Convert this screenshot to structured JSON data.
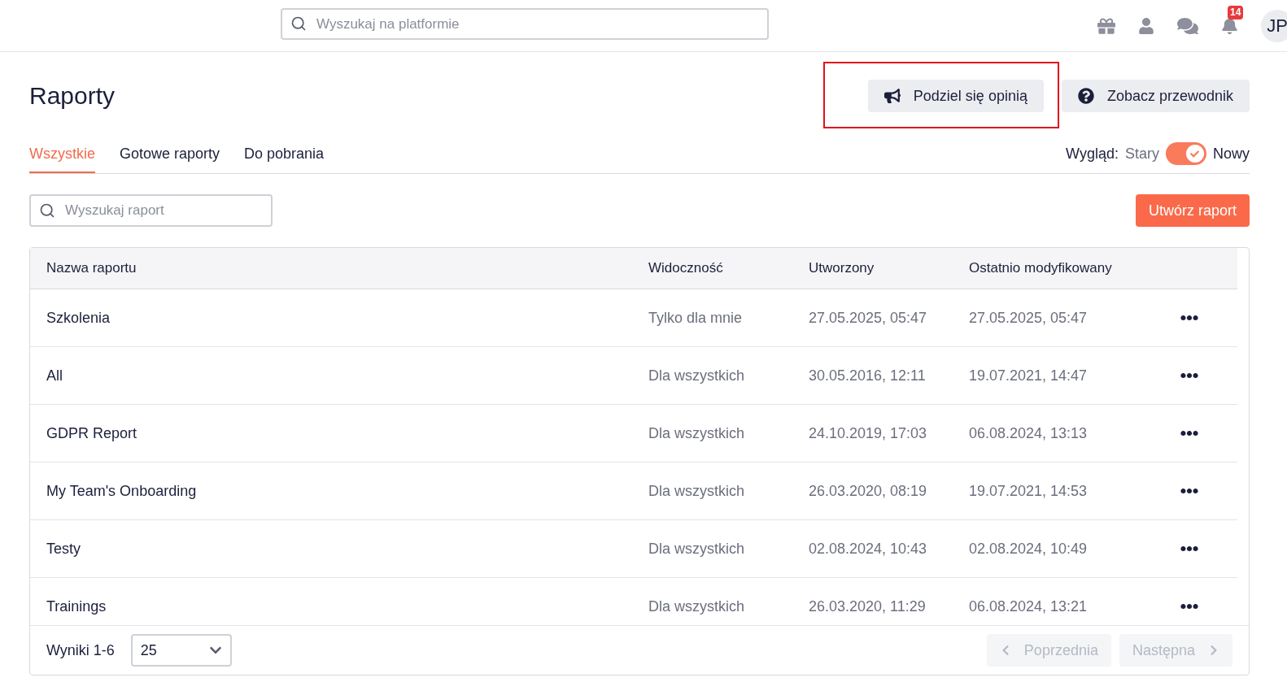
{
  "header": {
    "search": {
      "placeholder": "Wyszukaj na platformie"
    },
    "notifications_badge": "14",
    "avatar": "JP"
  },
  "page": {
    "title": "Raporty",
    "buttons": [
      {
        "kind": "feedback",
        "label": "Podziel się opinią",
        "highlighted": true
      },
      {
        "kind": "guide",
        "label": "Zobacz przewodnik",
        "highlighted": false
      }
    ]
  },
  "tabs": [
    {
      "label": "Wszystkie",
      "selected": true
    },
    {
      "label": "Gotowe raporty",
      "selected": false
    },
    {
      "label": "Do pobrania",
      "selected": false
    }
  ],
  "view_toggle": {
    "label": "Wygląd:",
    "off_label": "Stary",
    "on_label": "Nowy",
    "on": true
  },
  "report_search": {
    "placeholder": "Wyszukaj raport"
  },
  "create_button": "Utwórz raport",
  "table": {
    "columns": [
      "Nazwa raportu",
      "Widoczność",
      "Utworzony",
      "Ostatnio modyfikowany"
    ],
    "rows": [
      {
        "name": "Szkolenia",
        "visibility": "Tylko dla mnie",
        "created": "27.05.2025, 05:47",
        "modified": "27.05.2025, 05:47"
      },
      {
        "name": "All",
        "visibility": "Dla wszystkich",
        "created": "30.05.2016, 12:11",
        "modified": "19.07.2021, 14:47"
      },
      {
        "name": "GDPR Report",
        "visibility": "Dla wszystkich",
        "created": "24.10.2019, 17:03",
        "modified": "06.08.2024, 13:13"
      },
      {
        "name": "My Team's Onboarding",
        "visibility": "Dla wszystkich",
        "created": "26.03.2020, 08:19",
        "modified": "19.07.2021, 14:53"
      },
      {
        "name": "Testy",
        "visibility": "Dla wszystkich",
        "created": "02.08.2024, 10:43",
        "modified": "02.08.2024, 10:49"
      },
      {
        "name": "Trainings",
        "visibility": "Dla wszystkich",
        "created": "26.03.2020, 11:29",
        "modified": "06.08.2024, 13:21"
      }
    ]
  },
  "footer": {
    "results": "Wyniki 1-6",
    "page_size": "25",
    "prev": {
      "label": "Poprzednia",
      "disabled": true
    },
    "next": {
      "label": "Następna",
      "disabled": true
    }
  }
}
